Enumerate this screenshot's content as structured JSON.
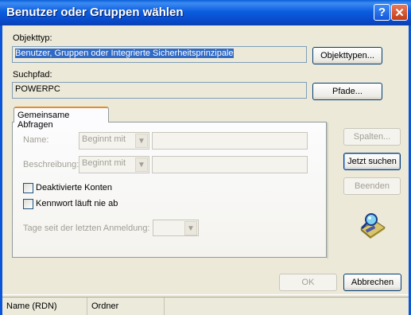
{
  "window": {
    "title": "Benutzer oder Gruppen wählen",
    "help_symbol": "?",
    "close_symbol": "✕"
  },
  "object_type": {
    "label": "Objekttyp:",
    "value": "Benutzer, Gruppen oder Integrierte Sicherheitsprinzipale",
    "button": "Objekttypen..."
  },
  "search_path": {
    "label": "Suchpfad:",
    "value": "POWERPC",
    "button": "Pfade..."
  },
  "tab": {
    "label": "Gemeinsame Abfragen"
  },
  "query": {
    "name_label": "Name:",
    "name_mode": "Beginnt mit",
    "desc_label": "Beschreibung:",
    "desc_mode": "Beginnt mit",
    "disabled_accounts": "Deaktivierte Konten",
    "password_never_expires": "Kennwort läuft nie ab",
    "last_login_label": "Tage seit der letzten Anmeldung:",
    "dropdown_arrow": "▼"
  },
  "side_buttons": {
    "columns": "Spalten...",
    "search_now": "Jetzt suchen",
    "stop": "Beenden"
  },
  "footer_buttons": {
    "ok": "OK",
    "cancel": "Abbrechen"
  },
  "results_columns": [
    "Name (RDN)",
    "Ordner"
  ],
  "icons": {
    "search_icon": "search-icon"
  }
}
